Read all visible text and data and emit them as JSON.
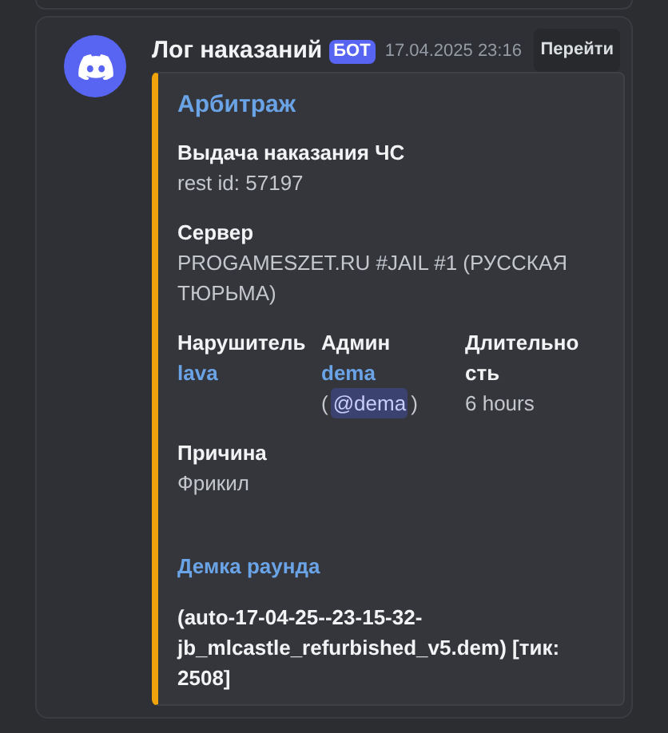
{
  "message": {
    "author": "Лог наказаний",
    "bot_tag": "БОТ",
    "timestamp": "17.04.2025 23:16",
    "jump_button": "Перейти"
  },
  "embed": {
    "title": "Арбитраж",
    "fields": [
      {
        "kind": "block",
        "name": "Выдача наказания ЧС",
        "value": "rest id: 57197"
      },
      {
        "kind": "block",
        "name": "Сервер",
        "value": "PROGAMESZET.RU #JAIL #1 (РУССКАЯ ТЮРЬМА)"
      },
      {
        "kind": "user",
        "name": "Нарушитель",
        "value": "lava"
      },
      {
        "kind": "user",
        "name": "Админ",
        "value": "dema",
        "mention_open": "(",
        "mention": "@dema",
        "mention_close": ")"
      },
      {
        "kind": "inline",
        "name": "Длительность",
        "value": "6 hours"
      },
      {
        "kind": "block",
        "name": "Причина",
        "value": "Фрикил"
      }
    ],
    "link_title": "Демка раунда",
    "description": "(auto-17-04-25--23-15-32-jb_mlcastle_refurbished_v5.dem) [тик: 2508]"
  }
}
